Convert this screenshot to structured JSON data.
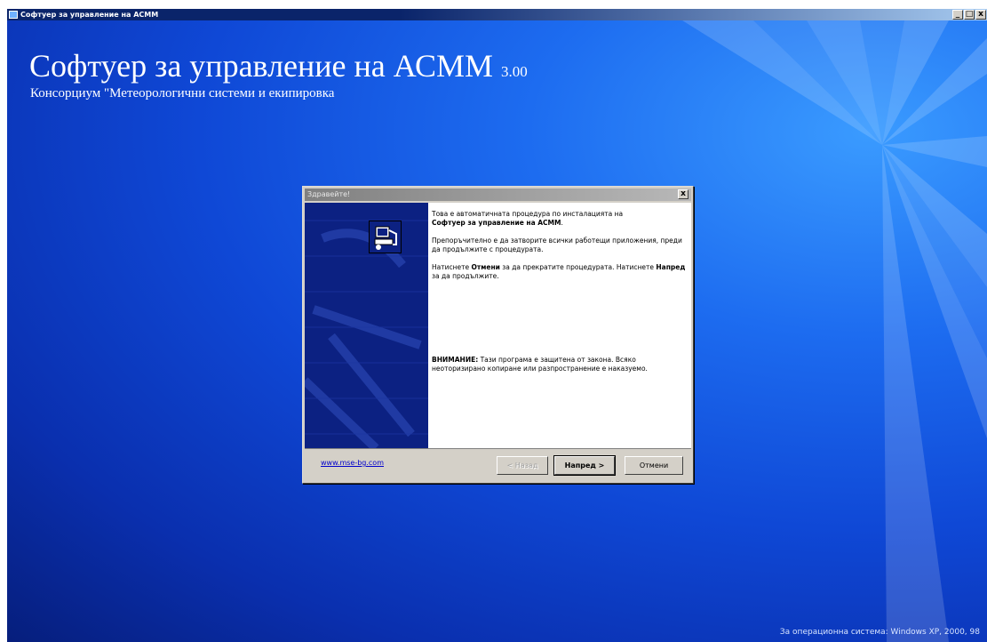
{
  "window": {
    "title": "Софтуер за управление на АСММ",
    "minimize": "_",
    "maximize": "□",
    "close": "x"
  },
  "installer": {
    "title": "Софтуер за управление на АСММ",
    "version": "3.00",
    "subtitle": "Консорциум \"Метеорологични системи и екипировка",
    "os_note": "За операционна система: Windows XP, 2000, 98"
  },
  "dialog": {
    "title": "Здравейте!",
    "close": "x",
    "para1_prefix": "Това е автоматичната процедура по инсталацията на",
    "para1_bold": "Софтуер за управление на АСММ",
    "para1_suffix": ".",
    "para2": "Препоръчително е да затворите всички работещи приложения, преди да продължите с процедурата.",
    "para3_a": "Натиснете ",
    "para3_cancel": "Отмени",
    "para3_b": " за да прекратите процедурата. Натиснете ",
    "para3_next": "Напред",
    "para3_c": " за да продължите.",
    "warning_label": "ВНИМАНИЕ:",
    "warning_text": " Тази програма е защитена от закона. Всяко неоторизирано копиране или разпространение е наказуемо.",
    "link": "www.mse-bg.com",
    "back_button": "< Назад",
    "next_button": "Напред >",
    "cancel_button": "Отмени"
  },
  "colors": {
    "desktop_blue": "#0f48d6",
    "side_panel": "#0c2182",
    "link": "#0000cc"
  },
  "icons": {
    "app": "installer-app-icon",
    "setup": "computer-setup-icon"
  }
}
